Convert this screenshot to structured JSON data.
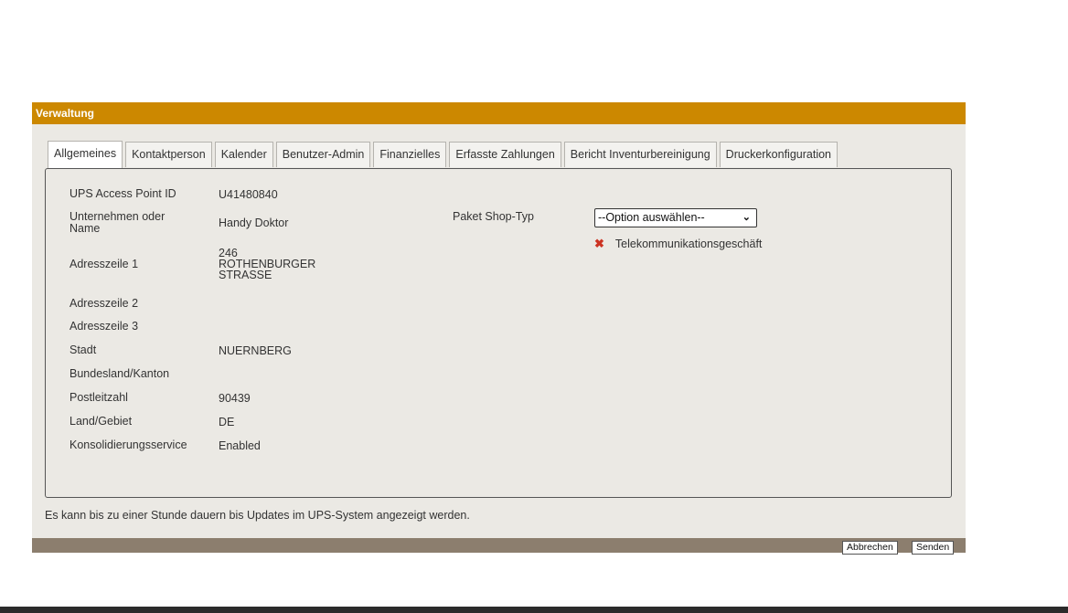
{
  "panel": {
    "title": "Verwaltung"
  },
  "tabs": [
    {
      "label": "Allgemeines",
      "active": true
    },
    {
      "label": "Kontaktperson"
    },
    {
      "label": "Kalender"
    },
    {
      "label": "Benutzer-Admin"
    },
    {
      "label": "Finanzielles"
    },
    {
      "label": "Erfasste Zahlungen"
    },
    {
      "label": "Bericht Inventurbereinigung"
    },
    {
      "label": "Druckerkonfiguration"
    }
  ],
  "fields": {
    "access_point_id": {
      "label": "UPS Access Point ID",
      "value": "U41480840"
    },
    "company": {
      "label_line1": "Unternehmen oder",
      "label_line2": "Name",
      "value": "Handy Doktor"
    },
    "address1": {
      "label": "Adresszeile 1",
      "value_line1": "246",
      "value_line2": "ROTHENBURGER",
      "value_line3": "STRASSE"
    },
    "address2": {
      "label": "Adresszeile 2",
      "value": ""
    },
    "address3": {
      "label": "Adresszeile 3",
      "value": ""
    },
    "city": {
      "label": "Stadt",
      "value": "NUERNBERG"
    },
    "state": {
      "label": "Bundesland/Kanton",
      "value": ""
    },
    "zip": {
      "label": "Postleitzahl",
      "value": "90439"
    },
    "country": {
      "label": "Land/Gebiet",
      "value": "DE"
    },
    "consolidation": {
      "label": "Konsolidierungsservice",
      "value": "Enabled"
    }
  },
  "shop_type": {
    "label": "Paket Shop-Typ",
    "select_value": "--Option auswählen--",
    "selected_tag": "Telekommunikationsgeschäft"
  },
  "note": "Es kann bis zu einer Stunde dauern bis Updates im UPS-System angezeigt werden.",
  "buttons": {
    "cancel": "Abbrechen",
    "submit": "Senden"
  },
  "colors": {
    "header": "#cc8800",
    "footer": "#8c7e6e",
    "background": "#ebe9e4"
  }
}
